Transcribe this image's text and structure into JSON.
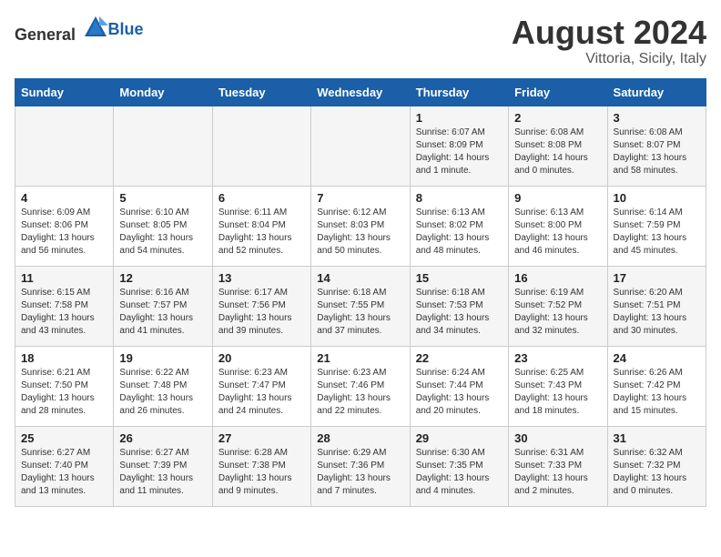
{
  "header": {
    "logo_general": "General",
    "logo_blue": "Blue",
    "month_year": "August 2024",
    "location": "Vittoria, Sicily, Italy"
  },
  "weekdays": [
    "Sunday",
    "Monday",
    "Tuesday",
    "Wednesday",
    "Thursday",
    "Friday",
    "Saturday"
  ],
  "weeks": [
    [
      {
        "day": "",
        "info": ""
      },
      {
        "day": "",
        "info": ""
      },
      {
        "day": "",
        "info": ""
      },
      {
        "day": "",
        "info": ""
      },
      {
        "day": "1",
        "info": "Sunrise: 6:07 AM\nSunset: 8:09 PM\nDaylight: 14 hours\nand 1 minute."
      },
      {
        "day": "2",
        "info": "Sunrise: 6:08 AM\nSunset: 8:08 PM\nDaylight: 14 hours\nand 0 minutes."
      },
      {
        "day": "3",
        "info": "Sunrise: 6:08 AM\nSunset: 8:07 PM\nDaylight: 13 hours\nand 58 minutes."
      }
    ],
    [
      {
        "day": "4",
        "info": "Sunrise: 6:09 AM\nSunset: 8:06 PM\nDaylight: 13 hours\nand 56 minutes."
      },
      {
        "day": "5",
        "info": "Sunrise: 6:10 AM\nSunset: 8:05 PM\nDaylight: 13 hours\nand 54 minutes."
      },
      {
        "day": "6",
        "info": "Sunrise: 6:11 AM\nSunset: 8:04 PM\nDaylight: 13 hours\nand 52 minutes."
      },
      {
        "day": "7",
        "info": "Sunrise: 6:12 AM\nSunset: 8:03 PM\nDaylight: 13 hours\nand 50 minutes."
      },
      {
        "day": "8",
        "info": "Sunrise: 6:13 AM\nSunset: 8:02 PM\nDaylight: 13 hours\nand 48 minutes."
      },
      {
        "day": "9",
        "info": "Sunrise: 6:13 AM\nSunset: 8:00 PM\nDaylight: 13 hours\nand 46 minutes."
      },
      {
        "day": "10",
        "info": "Sunrise: 6:14 AM\nSunset: 7:59 PM\nDaylight: 13 hours\nand 45 minutes."
      }
    ],
    [
      {
        "day": "11",
        "info": "Sunrise: 6:15 AM\nSunset: 7:58 PM\nDaylight: 13 hours\nand 43 minutes."
      },
      {
        "day": "12",
        "info": "Sunrise: 6:16 AM\nSunset: 7:57 PM\nDaylight: 13 hours\nand 41 minutes."
      },
      {
        "day": "13",
        "info": "Sunrise: 6:17 AM\nSunset: 7:56 PM\nDaylight: 13 hours\nand 39 minutes."
      },
      {
        "day": "14",
        "info": "Sunrise: 6:18 AM\nSunset: 7:55 PM\nDaylight: 13 hours\nand 37 minutes."
      },
      {
        "day": "15",
        "info": "Sunrise: 6:18 AM\nSunset: 7:53 PM\nDaylight: 13 hours\nand 34 minutes."
      },
      {
        "day": "16",
        "info": "Sunrise: 6:19 AM\nSunset: 7:52 PM\nDaylight: 13 hours\nand 32 minutes."
      },
      {
        "day": "17",
        "info": "Sunrise: 6:20 AM\nSunset: 7:51 PM\nDaylight: 13 hours\nand 30 minutes."
      }
    ],
    [
      {
        "day": "18",
        "info": "Sunrise: 6:21 AM\nSunset: 7:50 PM\nDaylight: 13 hours\nand 28 minutes."
      },
      {
        "day": "19",
        "info": "Sunrise: 6:22 AM\nSunset: 7:48 PM\nDaylight: 13 hours\nand 26 minutes."
      },
      {
        "day": "20",
        "info": "Sunrise: 6:23 AM\nSunset: 7:47 PM\nDaylight: 13 hours\nand 24 minutes."
      },
      {
        "day": "21",
        "info": "Sunrise: 6:23 AM\nSunset: 7:46 PM\nDaylight: 13 hours\nand 22 minutes."
      },
      {
        "day": "22",
        "info": "Sunrise: 6:24 AM\nSunset: 7:44 PM\nDaylight: 13 hours\nand 20 minutes."
      },
      {
        "day": "23",
        "info": "Sunrise: 6:25 AM\nSunset: 7:43 PM\nDaylight: 13 hours\nand 18 minutes."
      },
      {
        "day": "24",
        "info": "Sunrise: 6:26 AM\nSunset: 7:42 PM\nDaylight: 13 hours\nand 15 minutes."
      }
    ],
    [
      {
        "day": "25",
        "info": "Sunrise: 6:27 AM\nSunset: 7:40 PM\nDaylight: 13 hours\nand 13 minutes."
      },
      {
        "day": "26",
        "info": "Sunrise: 6:27 AM\nSunset: 7:39 PM\nDaylight: 13 hours\nand 11 minutes."
      },
      {
        "day": "27",
        "info": "Sunrise: 6:28 AM\nSunset: 7:38 PM\nDaylight: 13 hours\nand 9 minutes."
      },
      {
        "day": "28",
        "info": "Sunrise: 6:29 AM\nSunset: 7:36 PM\nDaylight: 13 hours\nand 7 minutes."
      },
      {
        "day": "29",
        "info": "Sunrise: 6:30 AM\nSunset: 7:35 PM\nDaylight: 13 hours\nand 4 minutes."
      },
      {
        "day": "30",
        "info": "Sunrise: 6:31 AM\nSunset: 7:33 PM\nDaylight: 13 hours\nand 2 minutes."
      },
      {
        "day": "31",
        "info": "Sunrise: 6:32 AM\nSunset: 7:32 PM\nDaylight: 13 hours\nand 0 minutes."
      }
    ]
  ]
}
